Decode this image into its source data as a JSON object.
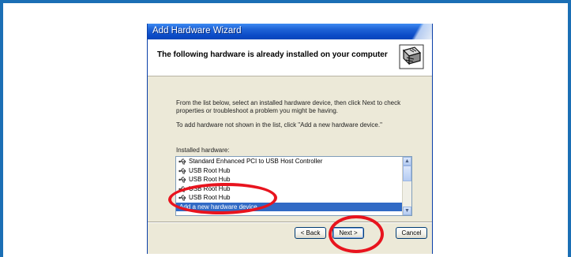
{
  "window": {
    "title": "Add Hardware Wizard",
    "header_title": "The following hardware is already installed on your computer"
  },
  "body": {
    "paragraph_1": "From the list below, select an installed hardware device, then click Next to check properties or troubleshoot a problem you might be having.",
    "paragraph_2": "To add hardware not shown in the list, click \"Add a new hardware device.\"",
    "list_label": "Installed hardware:"
  },
  "hardware_list": {
    "items": [
      {
        "label": "Standard Enhanced PCI to USB Host Controller",
        "icon": "usb-icon"
      },
      {
        "label": "USB Root Hub",
        "icon": "usb-icon"
      },
      {
        "label": "USB Root Hub",
        "icon": "usb-icon"
      },
      {
        "label": "USB Root Hub",
        "icon": "usb-icon"
      },
      {
        "label": "USB Root Hub",
        "icon": "usb-icon"
      },
      {
        "label": "Add a new hardware device",
        "selected": true
      }
    ]
  },
  "buttons": {
    "back": "< Back",
    "next": "Next >",
    "cancel": "Cancel"
  },
  "colors": {
    "background": "#1b6fb5",
    "selection": "#316ac5",
    "annotation": "#e8141e"
  }
}
